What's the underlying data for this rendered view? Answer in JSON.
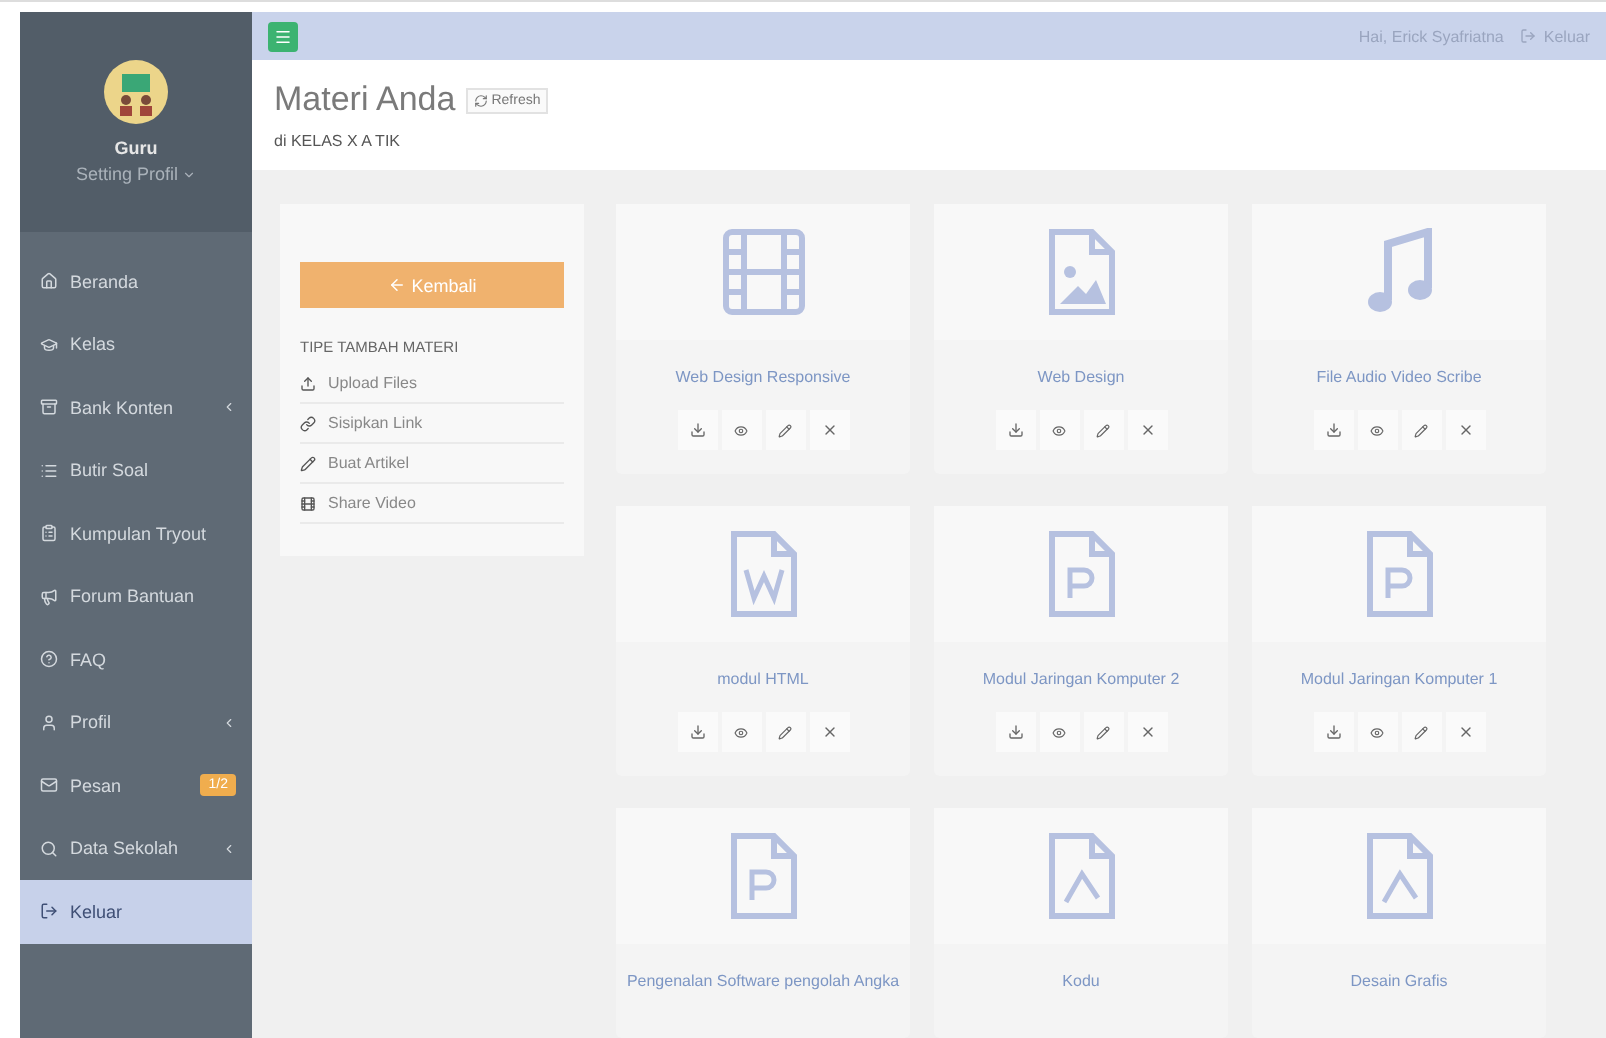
{
  "sidebar": {
    "user": {
      "name": "Guru",
      "setting": "Setting Profil"
    },
    "items": [
      {
        "kind": "home",
        "label": "Beranda",
        "selected": false,
        "submenu": false
      },
      {
        "kind": "class",
        "label": "Kelas",
        "selected": false,
        "submenu": false
      },
      {
        "kind": "bank",
        "label": "Bank Konten",
        "selected": false,
        "submenu": true
      },
      {
        "kind": "list",
        "label": "Butir Soal",
        "selected": false,
        "submenu": false
      },
      {
        "kind": "tryout",
        "label": "Kumpulan Tryout",
        "selected": false,
        "submenu": false
      },
      {
        "kind": "forum",
        "label": "Forum Bantuan",
        "selected": false,
        "submenu": false
      },
      {
        "kind": "faq",
        "label": "FAQ",
        "selected": false,
        "submenu": false
      },
      {
        "kind": "profile",
        "label": "Profil",
        "selected": false,
        "submenu": true
      },
      {
        "kind": "mail",
        "label": "Pesan",
        "selected": false,
        "submenu": false,
        "badge": "1/2"
      },
      {
        "kind": "school",
        "label": "Data Sekolah",
        "selected": false,
        "submenu": true
      },
      {
        "kind": "logout",
        "label": "Keluar",
        "selected": true,
        "submenu": false
      }
    ]
  },
  "header": {
    "greeting": "Hai, Erick Syafriatna",
    "logout": "Keluar"
  },
  "page": {
    "title": "Materi Anda",
    "refresh": "Refresh",
    "subtitle": "di KELAS X A TIK"
  },
  "panel": {
    "back": "Kembali",
    "heading": "TIPE TAMBAH MATERI",
    "options": [
      {
        "kind": "upload",
        "label": "Upload Files"
      },
      {
        "kind": "link",
        "label": "Sisipkan Link"
      },
      {
        "kind": "article",
        "label": "Buat Artikel"
      },
      {
        "kind": "video",
        "label": "Share Video"
      }
    ]
  },
  "cards": [
    {
      "kind": "film",
      "title": "Web Design Responsive",
      "actions": true
    },
    {
      "kind": "image",
      "title": "Web Design",
      "actions": true
    },
    {
      "kind": "audio",
      "title": "File Audio Video Scribe",
      "actions": true
    },
    {
      "kind": "word",
      "title": "modul HTML",
      "actions": true
    },
    {
      "kind": "powerpoint",
      "title": "Modul Jaringan Komputer 2",
      "actions": true
    },
    {
      "kind": "powerpoint",
      "title": "Modul Jaringan Komputer 1",
      "actions": true
    },
    {
      "kind": "powerpoint",
      "title": "Pengenalan Software pengolah Angka",
      "actions": false
    },
    {
      "kind": "pdf",
      "title": "Kodu",
      "actions": false
    },
    {
      "kind": "pdf",
      "title": "Desain Grafis",
      "actions": false
    }
  ]
}
